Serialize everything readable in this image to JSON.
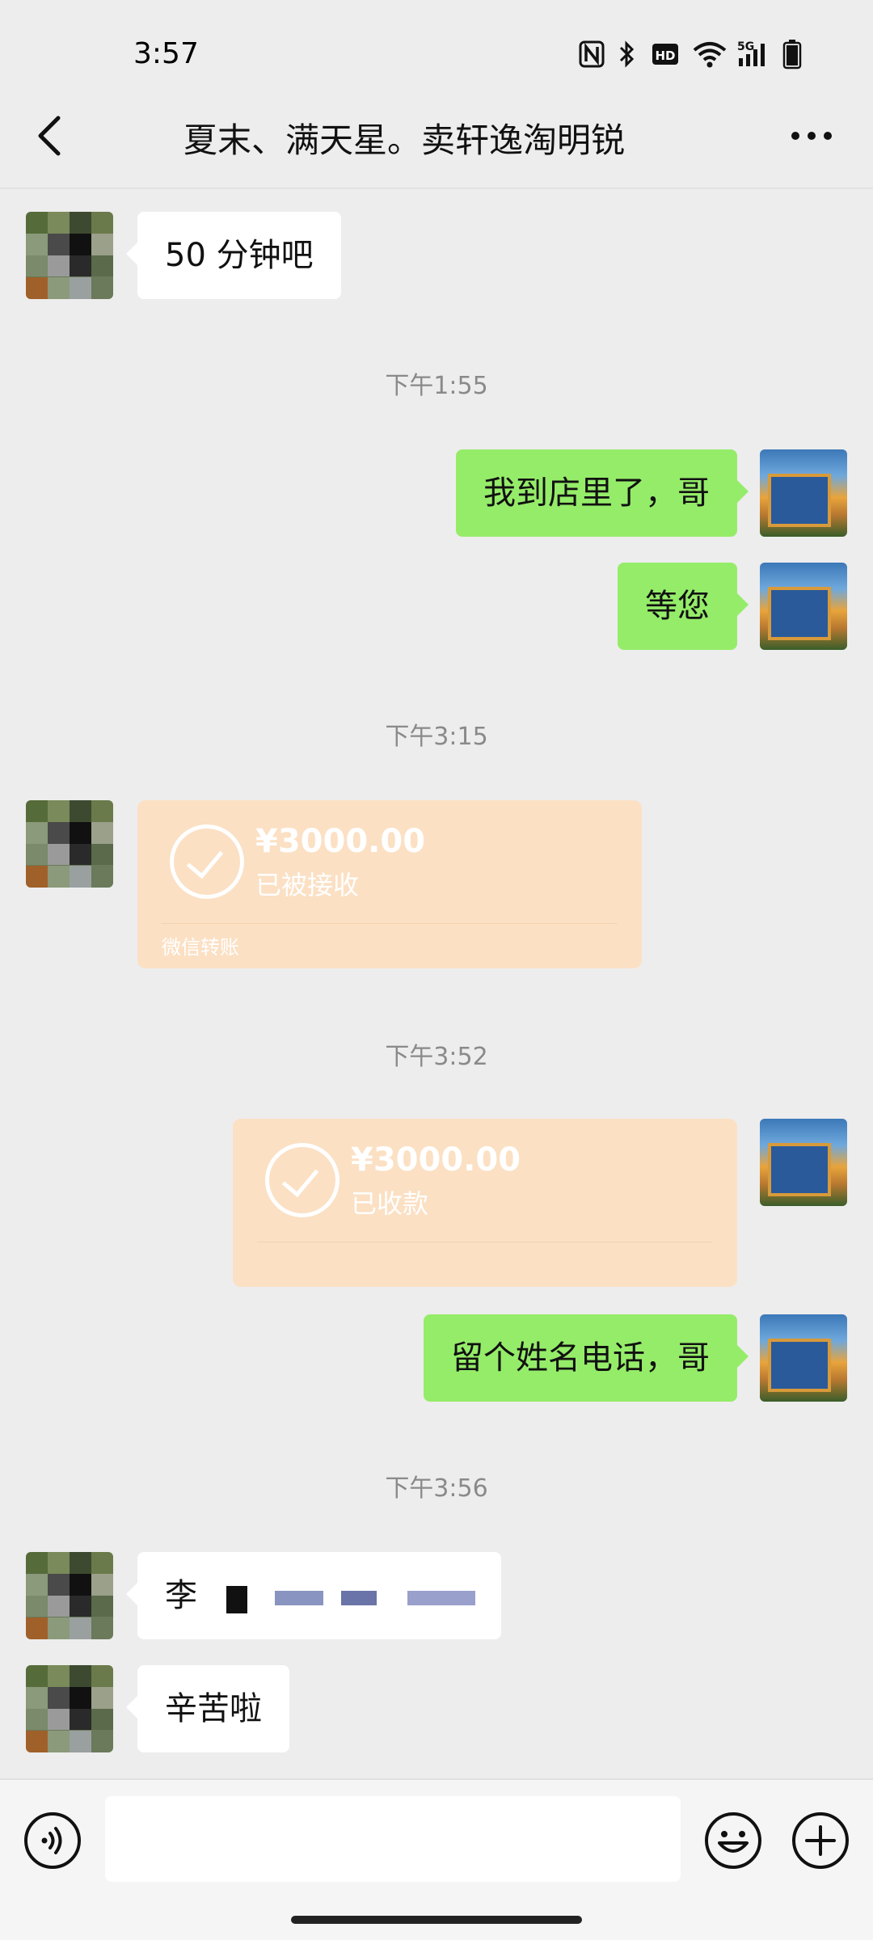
{
  "status_bar": {
    "time": "3:57",
    "icons": [
      "nfc-icon",
      "bluetooth-icon",
      "hd-icon",
      "wifi-icon",
      "5g-signal-icon",
      "battery-icon"
    ]
  },
  "header": {
    "title": "夏末、满天星。卖轩逸淘明锐",
    "back_icon": "chevron-left-icon",
    "more_icon": "more-dots-icon"
  },
  "messages": [
    {
      "side": "in",
      "text": "50 分钟吧"
    },
    {
      "timestamp": "下午1:55"
    },
    {
      "side": "out",
      "text": "我到店里了，哥"
    },
    {
      "side": "out",
      "text": "等您"
    },
    {
      "timestamp": "下午3:15"
    },
    {
      "side": "in",
      "type": "transfer",
      "amount": "¥3000.00",
      "status": "已被接收",
      "label": "微信转账"
    },
    {
      "timestamp": "下午3:52"
    },
    {
      "side": "out",
      "type": "transfer",
      "amount": "¥3000.00",
      "status": "已收款"
    },
    {
      "side": "out",
      "text": "留个姓名电话，哥"
    },
    {
      "timestamp": "下午3:56"
    },
    {
      "side": "in",
      "text": "李"
    },
    {
      "side": "in",
      "text": "辛苦啦"
    }
  ],
  "input_bar": {
    "voice_icon": "voice-icon",
    "input_value": "",
    "emoji_icon": "emoji-icon",
    "plus_icon": "plus-icon"
  },
  "colors": {
    "background": "#ededed",
    "bubble_out": "#95ec69",
    "bubble_in": "#ffffff",
    "transfer": "#fbe0c4"
  }
}
